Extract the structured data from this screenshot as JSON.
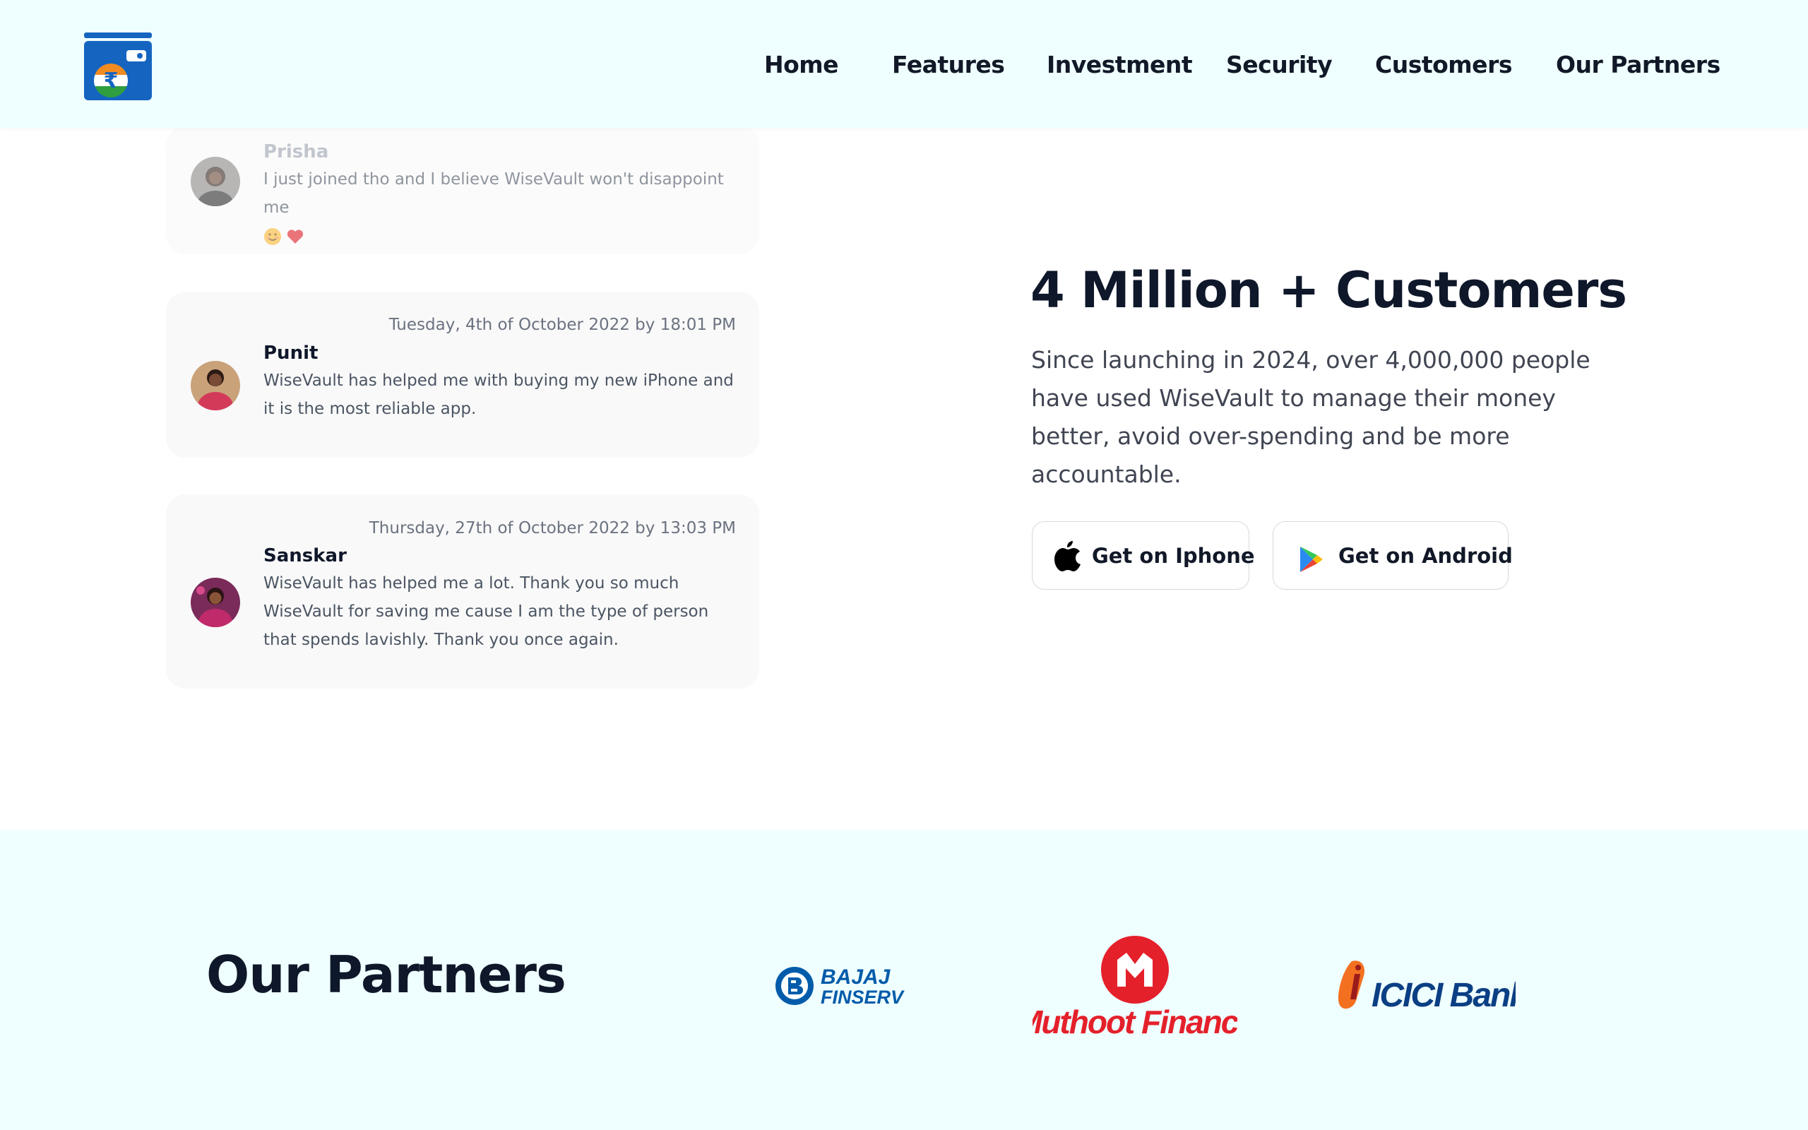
{
  "header": {
    "logo_name": "wallet-rupee-logo",
    "nav": [
      "Home",
      "Features",
      "Investment",
      "Security",
      "Customers",
      "Our Partners"
    ]
  },
  "testimonials": [
    {
      "name": "Prisha",
      "date": "",
      "text": "I just joined tho and I believe WiseVault won't disappoint me",
      "emojis": [
        "smiling-face-icon",
        "heart-icon"
      ]
    },
    {
      "name": "Punit",
      "date": "Tuesday, 4th of October 2022 by 18:01 PM",
      "text": "WiseVault has helped me with buying my new iPhone and it is the most reliable app."
    },
    {
      "name": "Sanskar",
      "date": "Thursday, 27th of October 2022 by 13:03 PM",
      "text": "WiseVault has helped me a lot. Thank you so much WiseVault for saving me cause I am the type of person that spends lavishly. Thank you once again."
    }
  ],
  "customers": {
    "title": "4 Million + Customers",
    "description": "Since launching in 2024, over 4,000,000 people have used WiseVault to manage their money better, avoid over-spending and be more accountable.",
    "iphone_label": "Get on Iphone",
    "android_label": "Get on Android"
  },
  "partners": {
    "title": "Our Partners",
    "logos": [
      {
        "name": "bajaj-finserv-logo",
        "lines": [
          "BAJAJ",
          "FINSERV"
        ]
      },
      {
        "name": "muthoot-finance-logo",
        "text": "Muthoot Finance"
      },
      {
        "name": "icici-bank-logo",
        "text": "ICICI Bank"
      }
    ]
  },
  "colors": {
    "header_bg": "#effefe",
    "card_bg": "#f9f9f9",
    "heading": "#0f172a",
    "logo_blue": "#1565c0",
    "bajaj_blue": "#005baa",
    "muthoot_red": "#e4202b",
    "icici_orange": "#f37021",
    "icici_blue": "#0b3f84"
  }
}
